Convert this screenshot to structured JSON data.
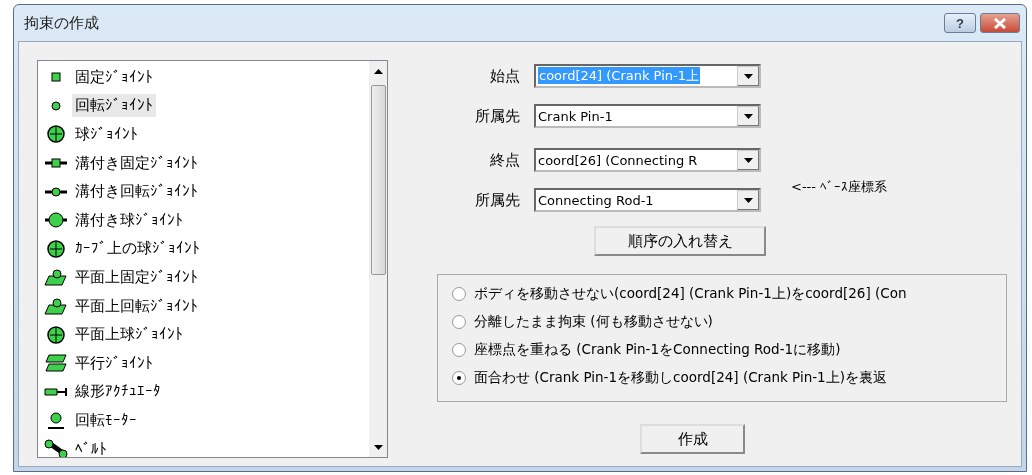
{
  "window": {
    "title": "拘束の作成",
    "help_button": "?"
  },
  "joint_list": {
    "items": [
      {
        "label": "固定ｼﾞｮｲﾝﾄ",
        "selected": false
      },
      {
        "label": "回転ｼﾞｮｲﾝﾄ",
        "selected": true
      },
      {
        "label": "球ｼﾞｮｲﾝﾄ",
        "selected": false
      },
      {
        "label": "溝付き固定ｼﾞｮｲﾝﾄ",
        "selected": false
      },
      {
        "label": "溝付き回転ｼﾞｮｲﾝﾄ",
        "selected": false
      },
      {
        "label": "溝付き球ｼﾞｮｲﾝﾄ",
        "selected": false
      },
      {
        "label": "ｶｰﾌﾞ上の球ｼﾞｮｲﾝﾄ",
        "selected": false
      },
      {
        "label": "平面上固定ｼﾞｮｲﾝﾄ",
        "selected": false
      },
      {
        "label": "平面上回転ｼﾞｮｲﾝﾄ",
        "selected": false
      },
      {
        "label": "平面上球ｼﾞｮｲﾝﾄ",
        "selected": false
      },
      {
        "label": "平行ｼﾞｮｲﾝﾄ",
        "selected": false
      },
      {
        "label": "線形ｱｸﾁｭｴｰﾀ",
        "selected": false
      },
      {
        "label": "回転ﾓｰﾀｰ",
        "selected": false
      },
      {
        "label": "ﾍﾞﾙﾄ",
        "selected": false
      }
    ]
  },
  "fields": [
    {
      "label": "始点",
      "value": "coord[24] (Crank Pin-1上",
      "highlighted": true
    },
    {
      "label": "所属先",
      "value": "Crank Pin-1",
      "highlighted": false
    },
    {
      "label": "終点",
      "value": "coord[26] (Connecting R",
      "highlighted": false
    },
    {
      "label": "所属先",
      "value": "Connecting Rod-1",
      "highlighted": false
    }
  ],
  "base_note": "<--- ﾍﾞｰｽ座標系",
  "swap_button": "順序の入れ替え",
  "options": [
    {
      "label": "ボディを移動させない(coord[24] (Crank Pin-1上)をcoord[26] (Con",
      "selected": false
    },
    {
      "label": "分離したまま拘束 (何も移動させない)",
      "selected": false
    },
    {
      "label": "座標点を重ねる (Crank Pin-1をConnecting Rod-1に移動)",
      "selected": false
    },
    {
      "label": "面合わせ (Crank Pin-1を移動しcoord[24] (Crank Pin-1上)を裏返",
      "selected": true
    }
  ],
  "create_button": "作成"
}
